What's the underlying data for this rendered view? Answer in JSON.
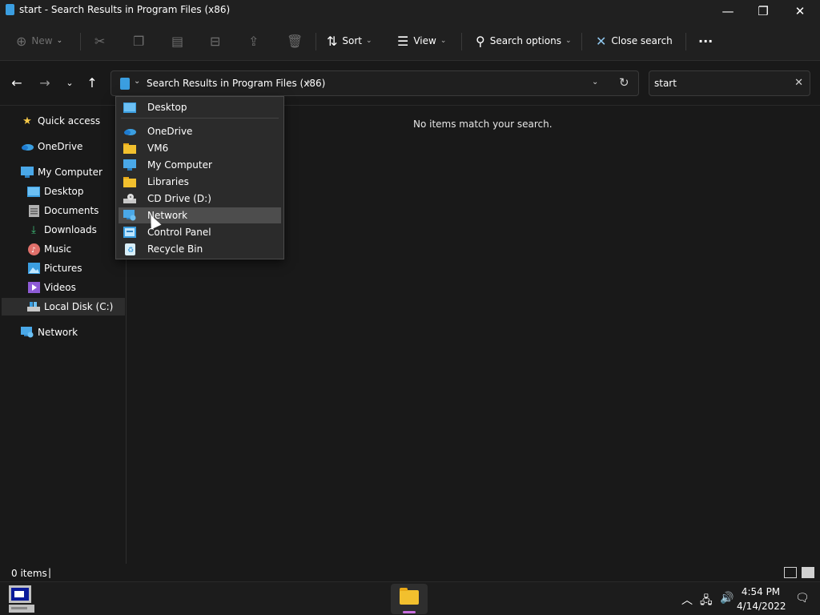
{
  "window": {
    "title": "start - Search Results in Program Files (x86)",
    "minimize": "—",
    "restore": "❐",
    "close": "✕"
  },
  "commandbar": {
    "new_label": "New",
    "sort_label": "Sort",
    "view_label": "View",
    "search_options_label": "Search options",
    "close_search_label": "Close search",
    "more": "···"
  },
  "address": {
    "path": "Search Results in Program Files (x86)",
    "separator": "›"
  },
  "search": {
    "value": "start",
    "clear": "✕"
  },
  "sidebar": {
    "items": [
      {
        "label": "Quick access",
        "icon": "star-icon"
      },
      {
        "label": "OneDrive",
        "icon": "cloud-icon"
      },
      {
        "label": "My Computer",
        "icon": "monitor-icon"
      },
      {
        "label": "Desktop",
        "icon": "desktop-icon"
      },
      {
        "label": "Documents",
        "icon": "document-icon"
      },
      {
        "label": "Downloads",
        "icon": "download-icon"
      },
      {
        "label": "Music",
        "icon": "music-icon"
      },
      {
        "label": "Pictures",
        "icon": "picture-icon"
      },
      {
        "label": "Videos",
        "icon": "video-icon"
      },
      {
        "label": "Local Disk (C:)",
        "icon": "drive-icon"
      },
      {
        "label": "Network",
        "icon": "network-icon"
      }
    ]
  },
  "content": {
    "empty_message": "No items match your search."
  },
  "dropdown": {
    "items": [
      {
        "label": "Desktop",
        "icon": "desktop-icon"
      },
      {
        "label": "OneDrive",
        "icon": "cloud-icon"
      },
      {
        "label": "VM6",
        "icon": "folder-icon"
      },
      {
        "label": "My Computer",
        "icon": "monitor-icon"
      },
      {
        "label": "Libraries",
        "icon": "folder-icon"
      },
      {
        "label": "CD Drive (D:)",
        "icon": "cd-drive-icon"
      },
      {
        "label": "Network",
        "icon": "network-icon"
      },
      {
        "label": "Control Panel",
        "icon": "control-panel-icon"
      },
      {
        "label": "Recycle Bin",
        "icon": "recycle-bin-icon"
      }
    ],
    "hovered": "Network"
  },
  "status": {
    "item_count": "0 items"
  },
  "taskbar": {
    "time": "4:54 PM",
    "date": "4/14/2022"
  },
  "colors": {
    "background": "#191919",
    "accent_blue": "#3b9ee0",
    "folder_yellow": "#f2c02e",
    "hover": "#4d4d4d"
  }
}
